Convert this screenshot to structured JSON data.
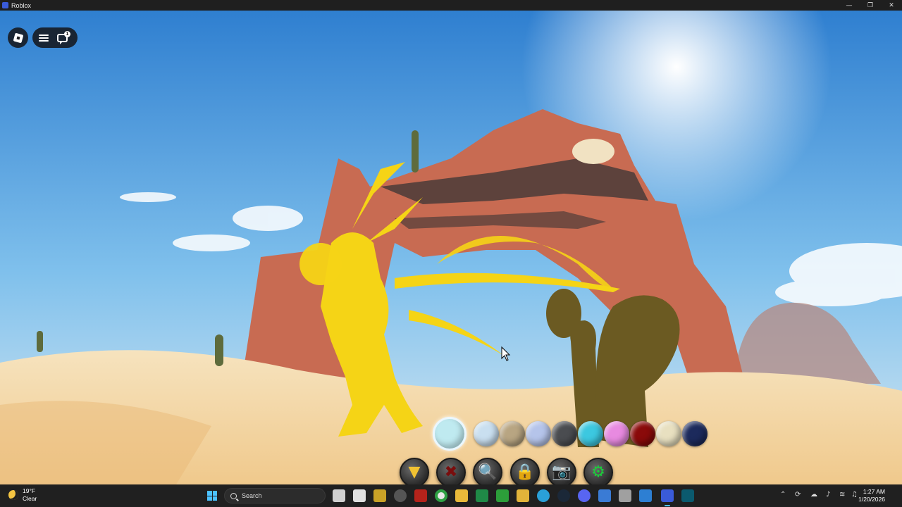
{
  "window": {
    "title": "Roblox",
    "minimize": "—",
    "maximize": "❐",
    "close": "✕"
  },
  "roblox_ui": {
    "chat_badge": "1"
  },
  "swatches": [
    {
      "name": "light-cyan",
      "color": "#bfeaf0",
      "selected": true
    },
    {
      "name": "pale-blue",
      "color": "#c9dff0",
      "selected": false
    },
    {
      "name": "tan",
      "color": "#b8a582",
      "selected": false
    },
    {
      "name": "lavender-blue",
      "color": "#b5c4ea",
      "selected": false
    },
    {
      "name": "dark-gray",
      "color": "#4a4c50",
      "selected": false
    },
    {
      "name": "cyan",
      "color": "#3cc8e0",
      "selected": false
    },
    {
      "name": "pink",
      "color": "#e88ae0",
      "selected": false
    },
    {
      "name": "dark-red",
      "color": "#8a0a0a",
      "selected": false
    },
    {
      "name": "cream",
      "color": "#e8e0c0",
      "selected": false
    },
    {
      "name": "navy",
      "color": "#1c2a5c",
      "selected": false
    }
  ],
  "tools": [
    {
      "name": "build-tool",
      "icon": "▼",
      "color": "#f1c232"
    },
    {
      "name": "delete-tool",
      "icon": "✖",
      "color": "#7a0d0d"
    },
    {
      "name": "inspect-tool",
      "icon": "🔍",
      "color": "#f1c232"
    },
    {
      "name": "lock-tool",
      "icon": "🔒",
      "color": "#e01818"
    },
    {
      "name": "camera-tool",
      "icon": "📷",
      "color": "#9fb8d6"
    },
    {
      "name": "settings-tool",
      "icon": "⚙",
      "color": "#19d13a"
    }
  ],
  "taskbar": {
    "weather_temp": "19°F",
    "weather_cond": "Clear",
    "search_placeholder": "Search",
    "time": "1:27 AM",
    "date": "1/20/2026"
  }
}
